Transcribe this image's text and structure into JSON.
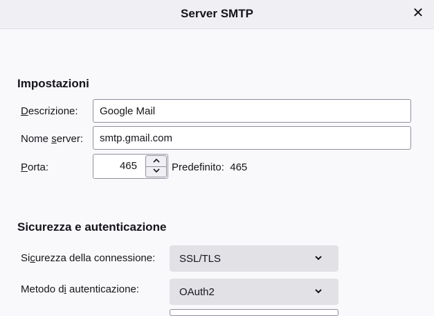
{
  "window": {
    "title": "Server SMTP",
    "close_label": "✕"
  },
  "sections": {
    "settings_heading": "Impostazioni",
    "security_heading": "Sicurezza e autenticazione"
  },
  "settings": {
    "description": {
      "label_key": "D",
      "label_rest": "escrizione:",
      "value": "Google Mail"
    },
    "server_name": {
      "label_pre": "Nome ",
      "label_key": "s",
      "label_rest": "erver:",
      "value": "smtp.gmail.com"
    },
    "port": {
      "label_key": "P",
      "label_rest": "orta:",
      "value": "465",
      "default_label": "Predefinito:",
      "default_value": "465"
    }
  },
  "security": {
    "connection": {
      "label_pre": "Si",
      "label_key": "c",
      "label_rest": "urezza della connessione:",
      "value": "SSL/TLS"
    },
    "auth_method": {
      "label_pre": "Metodo d",
      "label_key": "i",
      "label_rest": " autenticazione:",
      "value": "OAuth2"
    }
  }
}
